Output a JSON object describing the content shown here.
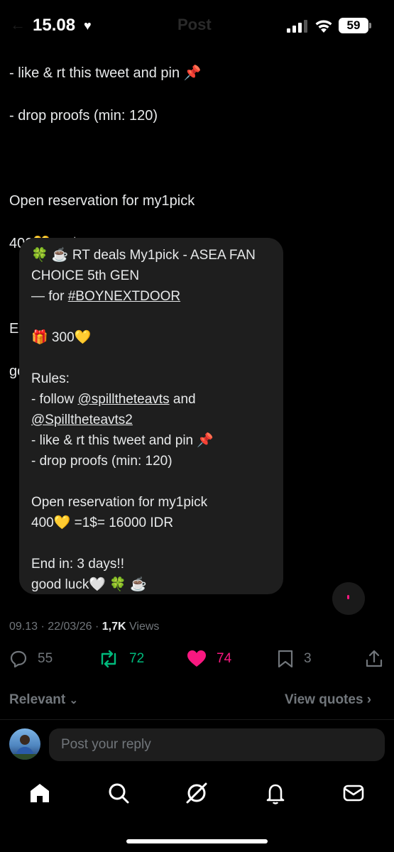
{
  "status_bar": {
    "time": "15.08",
    "battery": "59",
    "title_ghost": "Post"
  },
  "tweet": {
    "lines": [
      "- like & rt this tweet and pin 📌",
      "- drop proofs (min: 120)",
      "",
      "Open reservation for my1pick",
      "400💛 =1$= 16000 IDR",
      "",
      "End in: 3 days!!",
      "good luck🤍 🍀 ☕"
    ]
  },
  "quote": {
    "line1": "🍀 ☕ RT deals  My1pick - ASEA FAN",
    "line2": "CHOICE 5th GEN",
    "line3_prefix": "— for ",
    "hashtag": "#BOYNEXTDOOR",
    "gift": "🎁 300💛",
    "rules_label": "Rules:",
    "follow_prefix": "- follow ",
    "mention1": "@spilltheteavts",
    "follow_and": " and",
    "mention2": "@Spilltheteavts2",
    "rule_like": "- like & rt this tweet and pin 📌",
    "rule_drop": "- drop proofs (min: 120)",
    "reservation": "Open reservation for my1pick",
    "rate": "400💛 =1$= 16000 IDR",
    "end": "End in: 3 days!!",
    "goodluck": "good luck🤍 🍀 ☕"
  },
  "meta": {
    "time": "09.13",
    "date": "22/03/26",
    "views_count": "1,7K",
    "views_label": "Views"
  },
  "actions": {
    "replies": "55",
    "retweets": "72",
    "likes": "74",
    "bookmarks": "3"
  },
  "colors": {
    "retweet": "#00ba7c",
    "like": "#f91880",
    "muted": "#71767b"
  },
  "sort": {
    "relevant": "Relevant",
    "view_quotes": "View quotes"
  },
  "reply": {
    "placeholder": "Post your reply"
  },
  "nav": [
    "home-icon",
    "search-icon",
    "grok-icon",
    "notifications-icon",
    "messages-icon"
  ]
}
